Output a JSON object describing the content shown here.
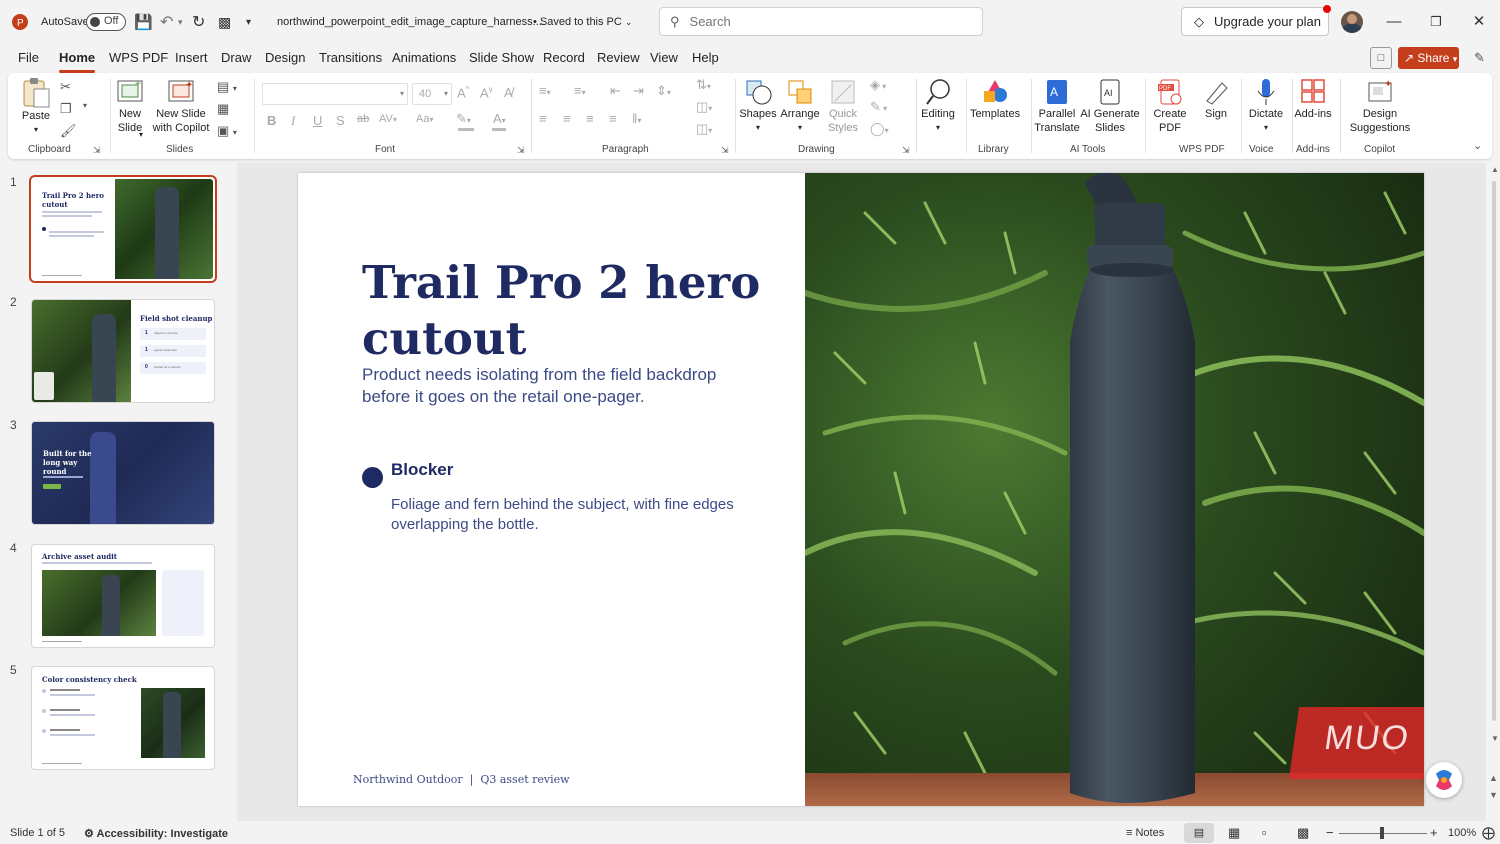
{
  "app": {
    "autosave_label": "AutoSave",
    "autosave_state": "Off",
    "file_name": "northwind_powerpoint_edit_image_capture_harness....",
    "save_status": "• Saved to this PC",
    "search_placeholder": "Search",
    "upgrade_label": "Upgrade your plan"
  },
  "tabs": [
    "File",
    "Home",
    "WPS PDF",
    "Insert",
    "Draw",
    "Design",
    "Transitions",
    "Animations",
    "Slide Show",
    "Record",
    "Review",
    "View",
    "Help"
  ],
  "share_label": "Share",
  "ribbon": {
    "paste": "Paste",
    "new_slide": "New\nSlide",
    "new_slide_copilot": "New Slide\nwith Copilot",
    "font_size": "40",
    "shapes": "Shapes",
    "arrange": "Arrange",
    "quick_styles": "Quick\nStyles",
    "editing": "Editing",
    "templates": "Templates",
    "parallel_translate": "Parallel\nTranslate",
    "ai_generate": "AI Generate\nSlides",
    "create_pdf": "Create\nPDF",
    "sign": "Sign",
    "dictate": "Dictate",
    "add_ins": "Add-ins",
    "design_suggestions": "Design\nSuggestions",
    "groups": {
      "clipboard": "Clipboard",
      "slides": "Slides",
      "font": "Font",
      "paragraph": "Paragraph",
      "drawing": "Drawing",
      "library": "Library",
      "ai_tools": "AI Tools",
      "wps_pdf": "WPS PDF",
      "voice": "Voice",
      "add_ins": "Add-ins",
      "copilot": "Copilot"
    }
  },
  "thumbnails": [
    {
      "num": "1",
      "title": "Trail Pro 2 hero cutout"
    },
    {
      "num": "2",
      "title": "Field shot cleanup",
      "items": [
        [
          "1",
          "objects to remove"
        ],
        [
          "1",
          "egress statement"
        ],
        [
          "0",
          "budget for a retouch"
        ]
      ]
    },
    {
      "num": "3",
      "title": "Built for the long way round"
    },
    {
      "num": "4",
      "title": "Archive asset audit"
    },
    {
      "num": "5",
      "title": "Color consistency check"
    }
  ],
  "slide": {
    "title": "Trail Pro 2 hero cutout",
    "subtitle": "Product needs isolating from the field backdrop before it goes on the retail one-pager.",
    "bullet_heading": "Blocker",
    "bullet_body": "Foliage and fern behind the subject, with fine edges overlapping the bottle.",
    "footer": "Northwind Outdoor  |  Q3 asset review",
    "watermark": "MUO"
  },
  "status": {
    "slide_counter": "Slide 1 of 5",
    "accessibility": "Accessibility: Investigate",
    "notes": "Notes",
    "zoom": "100%"
  },
  "colors": {
    "accent": "#c43e1c",
    "title_navy": "#1f2a63",
    "body_blue": "#3d4a86"
  }
}
